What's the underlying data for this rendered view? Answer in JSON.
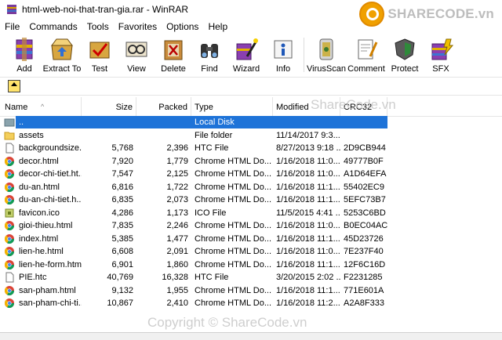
{
  "window": {
    "title": "html-web-noi-that-tran-gia.rar - WinRAR"
  },
  "watermark": {
    "logo_text": "SHARECODE.vn",
    "mid_text": "ShareCode.vn",
    "bottom_text": "Copyright © ShareCode.vn"
  },
  "menu": [
    "File",
    "Commands",
    "Tools",
    "Favorites",
    "Options",
    "Help"
  ],
  "toolbar": [
    {
      "label": "Add",
      "icon": "add-icon"
    },
    {
      "label": "Extract To",
      "icon": "extract-icon"
    },
    {
      "label": "Test",
      "icon": "test-icon"
    },
    {
      "label": "View",
      "icon": "view-icon"
    },
    {
      "label": "Delete",
      "icon": "delete-icon"
    },
    {
      "label": "Find",
      "icon": "find-icon"
    },
    {
      "label": "Wizard",
      "icon": "wizard-icon"
    },
    {
      "label": "Info",
      "icon": "info-icon"
    },
    {
      "label": "VirusScan",
      "icon": "virusscan-icon"
    },
    {
      "label": "Comment",
      "icon": "comment-icon"
    },
    {
      "label": "Protect",
      "icon": "protect-icon"
    },
    {
      "label": "SFX",
      "icon": "sfx-icon"
    }
  ],
  "columns": {
    "name": "Name",
    "size": "Size",
    "packed": "Packed",
    "type": "Type",
    "modified": "Modified",
    "crc": "CRC32"
  },
  "files": [
    {
      "name": "..",
      "size": "",
      "packed": "",
      "type": "Local Disk",
      "modified": "",
      "crc": "",
      "icon": "parent-folder-icon",
      "selected": true
    },
    {
      "name": "assets",
      "size": "",
      "packed": "",
      "type": "File folder",
      "modified": "11/14/2017 9:3...",
      "crc": "",
      "icon": "folder-icon"
    },
    {
      "name": "backgroundsize....",
      "size": "5,768",
      "packed": "2,396",
      "type": "HTC File",
      "modified": "8/27/2013 9:18 ...",
      "crc": "2D9CB944",
      "icon": "file-icon"
    },
    {
      "name": "decor.html",
      "size": "7,920",
      "packed": "1,779",
      "type": "Chrome HTML Do...",
      "modified": "1/16/2018 11:0...",
      "crc": "49777B0F",
      "icon": "chrome-icon"
    },
    {
      "name": "decor-chi-tiet.ht...",
      "size": "7,547",
      "packed": "2,125",
      "type": "Chrome HTML Do...",
      "modified": "1/16/2018 11:0...",
      "crc": "A1D64EFA",
      "icon": "chrome-icon"
    },
    {
      "name": "du-an.html",
      "size": "6,816",
      "packed": "1,722",
      "type": "Chrome HTML Do...",
      "modified": "1/16/2018 11:1...",
      "crc": "55402EC9",
      "icon": "chrome-icon"
    },
    {
      "name": "du-an-chi-tiet.h...",
      "size": "6,835",
      "packed": "2,073",
      "type": "Chrome HTML Do...",
      "modified": "1/16/2018 11:1...",
      "crc": "5EFC73B7",
      "icon": "chrome-icon"
    },
    {
      "name": "favicon.ico",
      "size": "4,286",
      "packed": "1,173",
      "type": "ICO File",
      "modified": "11/5/2015 4:41 ...",
      "crc": "5253C6BD",
      "icon": "image-file-icon"
    },
    {
      "name": "gioi-thieu.html",
      "size": "7,835",
      "packed": "2,246",
      "type": "Chrome HTML Do...",
      "modified": "1/16/2018 11:0...",
      "crc": "B0EC04AC",
      "icon": "chrome-icon"
    },
    {
      "name": "index.html",
      "size": "5,385",
      "packed": "1,477",
      "type": "Chrome HTML Do...",
      "modified": "1/16/2018 11:1...",
      "crc": "45D23726",
      "icon": "chrome-icon"
    },
    {
      "name": "lien-he.html",
      "size": "6,608",
      "packed": "2,091",
      "type": "Chrome HTML Do...",
      "modified": "1/16/2018 11:0...",
      "crc": "7E237F40",
      "icon": "chrome-icon"
    },
    {
      "name": "lien-he-form.html",
      "size": "6,901",
      "packed": "1,860",
      "type": "Chrome HTML Do...",
      "modified": "1/16/2018 11:1...",
      "crc": "12F6C16D",
      "icon": "chrome-icon"
    },
    {
      "name": "PIE.htc",
      "size": "40,769",
      "packed": "16,328",
      "type": "HTC File",
      "modified": "3/20/2015 2:02 ...",
      "crc": "F2231285",
      "icon": "file-icon"
    },
    {
      "name": "san-pham.html",
      "size": "9,132",
      "packed": "1,955",
      "type": "Chrome HTML Do...",
      "modified": "1/16/2018 11:1...",
      "crc": "771E601A",
      "icon": "chrome-icon"
    },
    {
      "name": "san-pham-chi-ti...",
      "size": "10,867",
      "packed": "2,410",
      "type": "Chrome HTML Do...",
      "modified": "1/16/2018 11:2...",
      "crc": "A2A8F333",
      "icon": "chrome-icon"
    }
  ]
}
